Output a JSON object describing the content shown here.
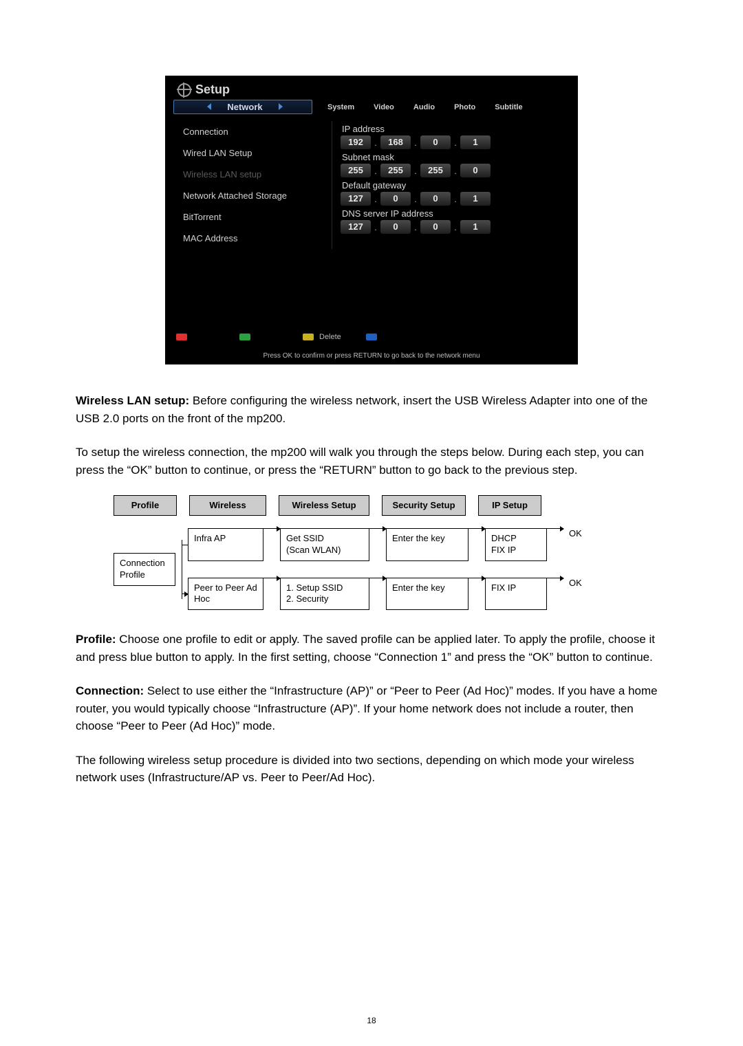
{
  "screenshot": {
    "title": "Setup",
    "active_tab": "Network",
    "inactive_tabs": [
      "System",
      "Video",
      "Audio",
      "Photo",
      "Subtitle"
    ],
    "menu_items": [
      {
        "label": "Connection",
        "disabled": false
      },
      {
        "label": "Wired LAN Setup",
        "disabled": false
      },
      {
        "label": "Wireless LAN setup",
        "disabled": true
      },
      {
        "label": "Network Attached Storage",
        "disabled": false
      },
      {
        "label": "BitTorrent",
        "disabled": false
      },
      {
        "label": "MAC Address",
        "disabled": false
      }
    ],
    "right_panel": {
      "ip_label": "IP address",
      "ip": [
        "192",
        "168",
        "0",
        "1"
      ],
      "mask_label": "Subnet mask",
      "mask": [
        "255",
        "255",
        "255",
        "0"
      ],
      "gw_label": "Default gateway",
      "gw": [
        "127",
        "0",
        "0",
        "1"
      ],
      "dns_label": "DNS server IP address",
      "dns": [
        "127",
        "0",
        "0",
        "1"
      ]
    },
    "footer_delete": "Delete",
    "hint": "Press OK to confirm or press RETURN to go back to the network menu"
  },
  "text": {
    "p1_lead": "Wireless LAN setup:",
    "p1_rest": " Before configuring the wireless network, insert the USB Wireless Adapter into one of the USB 2.0 ports on the front of the mp200.",
    "p2": "To setup the wireless connection, the mp200 will walk you through the steps below. During each step, you can press the “OK” button to continue, or press the “RETURN” button to go back to the previous step.",
    "p3_lead": "Profile:",
    "p3_rest": " Choose one profile to edit or apply. The saved profile can be applied later. To apply the profile, choose it and press blue button to apply. In the first setting, choose “Connection 1” and press the “OK” button to continue.",
    "p4_lead": "Connection:",
    "p4_rest": " Select to use either the “Infrastructure (AP)” or “Peer to Peer (Ad Hoc)” modes. If you have a home router, you would typically choose “Infrastructure (AP)”. If your home network does not include a router, then choose “Peer to Peer (Ad Hoc)” mode.",
    "p5": "The following wireless setup procedure is divided into two sections, depending on which mode your wireless network uses (Infrastructure/AP vs. Peer to Peer/Ad Hoc)."
  },
  "flow": {
    "headers": [
      "Profile",
      "Wireless",
      "Wireless Setup",
      "Security Setup",
      "IP Setup"
    ],
    "start": "Connection Profile",
    "row1": {
      "wireless": "Infra AP",
      "setup_l1": "Get SSID",
      "setup_l2": "(Scan WLAN)",
      "security": "Enter the key",
      "ip_l1": "DHCP",
      "ip_l2": "FIX IP",
      "end": "OK"
    },
    "row2": {
      "wireless": "Peer to Peer Ad Hoc",
      "setup_l1": "1. Setup SSID",
      "setup_l2": "2. Security",
      "security": "Enter the key",
      "ip": "FIX IP",
      "end": "OK"
    }
  },
  "page_number": "18"
}
